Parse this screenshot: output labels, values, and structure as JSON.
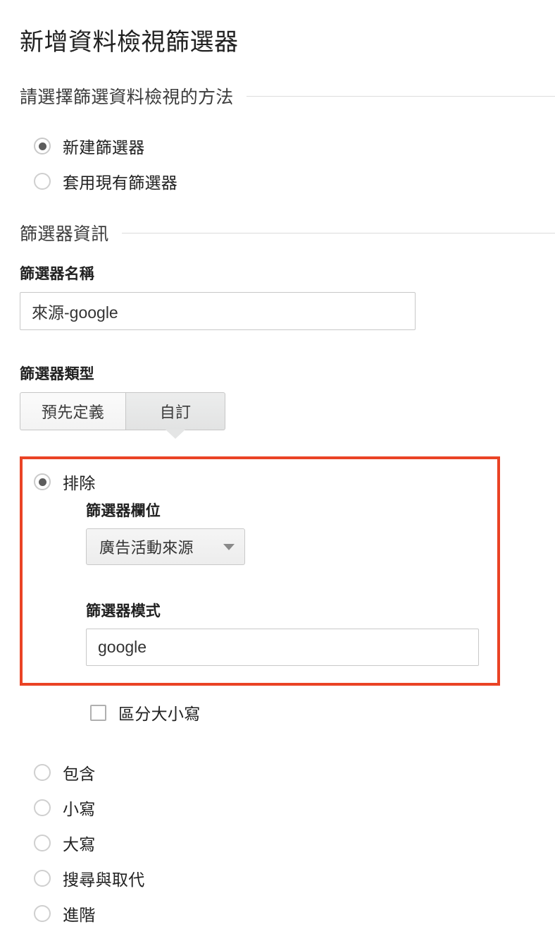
{
  "title": "新增資料檢視篩選器",
  "sections": {
    "method": {
      "heading": "請選擇篩選資料檢視的方法"
    },
    "info": {
      "heading": "篩選器資訊"
    }
  },
  "method_options": [
    {
      "label": "新建篩選器",
      "selected": true
    },
    {
      "label": "套用現有篩選器",
      "selected": false
    }
  ],
  "filter_name": {
    "label": "篩選器名稱",
    "value": "來源-google",
    "placeholder": ""
  },
  "filter_type": {
    "label": "篩選器類型",
    "tabs": [
      {
        "label": "預先定義",
        "selected": false
      },
      {
        "label": "自訂",
        "selected": true
      }
    ]
  },
  "custom_filter": {
    "exclude": {
      "label": "排除",
      "selected": true
    },
    "filter_field": {
      "label": "篩選器欄位",
      "value": "廣告活動來源",
      "caret_icon": "chevron-down-icon"
    },
    "filter_pattern": {
      "label": "篩選器模式",
      "value": "google",
      "placeholder": ""
    },
    "highlight_color": "#ea4325"
  },
  "case_sensitive": {
    "label": "區分大小寫",
    "checked": false
  },
  "other_options": [
    {
      "label": "包含",
      "selected": false
    },
    {
      "label": "小寫",
      "selected": false
    },
    {
      "label": "大寫",
      "selected": false
    },
    {
      "label": "搜尋與取代",
      "selected": false
    },
    {
      "label": "進階",
      "selected": false
    }
  ]
}
